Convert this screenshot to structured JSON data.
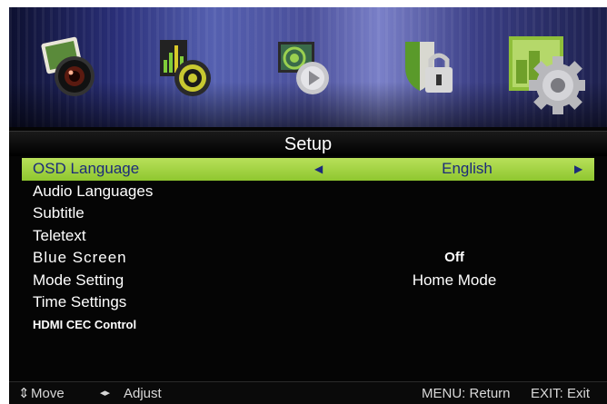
{
  "menu": {
    "title": "Setup",
    "tabs": [
      {
        "icon": "picture-camera-icon"
      },
      {
        "icon": "sound-speaker-icon"
      },
      {
        "icon": "channel-satellite-icon"
      },
      {
        "icon": "lock-shield-icon"
      },
      {
        "icon": "setup-gear-icon",
        "selected": true
      }
    ],
    "items": [
      {
        "label": "OSD Language",
        "value": "English"
      },
      {
        "label": "Audio Languages",
        "value": ""
      },
      {
        "label": "Subtitle",
        "value": ""
      },
      {
        "label": "Teletext",
        "value": ""
      },
      {
        "label": "Blue Screen",
        "value": "Off"
      },
      {
        "label": "Mode Setting",
        "value": "Home Mode"
      },
      {
        "label": "Time Settings",
        "value": ""
      },
      {
        "label": "HDMI CEC Control",
        "value": ""
      }
    ]
  },
  "footer": {
    "move_icon": "⇕",
    "move_label": "Move",
    "adjust_icon": "◂▸",
    "adjust_label": "Adjust",
    "menu_hint": "MENU: Return",
    "exit_hint": "EXIT: Exit"
  },
  "colors": {
    "selected_row": "#a6d444",
    "selected_text": "#1c2b7a",
    "background": "#050505",
    "text": "#ffffff"
  }
}
